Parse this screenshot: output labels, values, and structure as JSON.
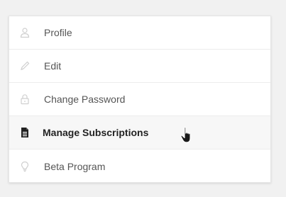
{
  "menu": {
    "items": [
      {
        "label": "Profile",
        "icon": "user-icon",
        "active": false
      },
      {
        "label": "Edit",
        "icon": "pencil-icon",
        "active": false
      },
      {
        "label": "Change Password",
        "icon": "lock-icon",
        "active": false
      },
      {
        "label": "Manage Subscriptions",
        "icon": "document-icon",
        "active": true
      },
      {
        "label": "Beta Program",
        "icon": "lightbulb-icon",
        "active": false
      }
    ]
  },
  "colors": {
    "background": "#f1f1f1",
    "card": "#ffffff",
    "active_row": "#f7f7f7",
    "icon_inactive": "#cfcfcf",
    "icon_active": "#222222"
  }
}
